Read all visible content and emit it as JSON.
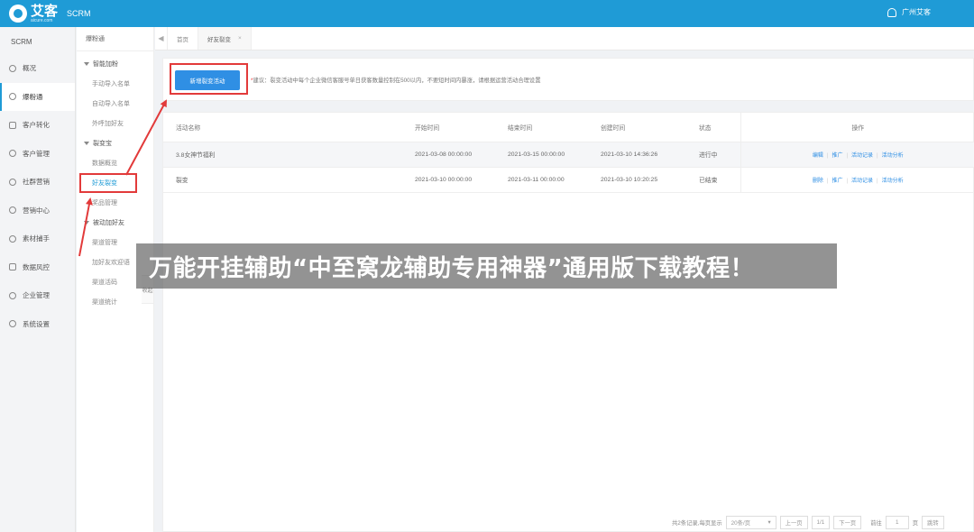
{
  "app": {
    "logo_text": "艾客",
    "logo_url": "aicure.com",
    "product": "SCRM",
    "user_name": "广州艾客"
  },
  "leftnav": {
    "brand": "SCRM",
    "items": [
      {
        "label": "概况",
        "icon": "home-icon"
      },
      {
        "label": "爆粉通",
        "icon": "user-icon",
        "active": true
      },
      {
        "label": "客户转化",
        "icon": "convert-icon"
      },
      {
        "label": "客户管理",
        "icon": "customers-icon"
      },
      {
        "label": "社群营销",
        "icon": "group-icon"
      },
      {
        "label": "营销中心",
        "icon": "marketing-icon"
      },
      {
        "label": "素材捕手",
        "icon": "material-icon"
      },
      {
        "label": "数据风控",
        "icon": "shield-icon"
      },
      {
        "label": "企业管理",
        "icon": "company-icon"
      },
      {
        "label": "系统设置",
        "icon": "gear-icon"
      }
    ]
  },
  "subnav": {
    "head": "爆粉通",
    "groups": [
      {
        "label": "智能加粉",
        "items": [
          "手动导入名单",
          "自动导入名单",
          "外呼加好友"
        ]
      },
      {
        "label": "裂变宝",
        "items": [
          "数据概览",
          "好友裂变",
          "奖品管理"
        ]
      },
      {
        "label": "被动加好友",
        "items": [
          "渠道管理",
          "加好友欢迎语",
          "渠道活码",
          "渠道统计"
        ]
      }
    ],
    "collapse_label": "收起"
  },
  "tabs": {
    "left_arrow": "◀",
    "items": [
      {
        "label": "首页"
      },
      {
        "label": "好友裂变",
        "close": "×"
      }
    ]
  },
  "toolbar": {
    "new_button": "新增裂变活动",
    "tip_star": "*",
    "tip": "建议：裂变活动中每个企业微信客服号单日获客数量控制在500以内，不要短时间内暴涨，请根据运营活动合理设置"
  },
  "table": {
    "headers": [
      "活动名称",
      "开始时间",
      "结束时间",
      "创建时间",
      "状态",
      "操作"
    ],
    "rows": [
      {
        "name": "3.8女神节福利",
        "start": "2021-03-08 00:00:00",
        "end": "2021-03-15 00:00:00",
        "created": "2021-03-10 14:36:26",
        "status": "进行中",
        "ops": [
          "编辑",
          "推广",
          "活动记录",
          "活动分析"
        ]
      },
      {
        "name": "裂变",
        "start": "2021-03-10 00:00:00",
        "end": "2021-03-11 00:00:00",
        "created": "2021-03-10 10:20:25",
        "status": "已结束",
        "ops": [
          "删除",
          "推广",
          "活动记录",
          "活动分析"
        ]
      }
    ]
  },
  "pager": {
    "summary": "共2条记录,每页显示",
    "page_size": "20条/页",
    "prev": "上一页",
    "page": "1/1",
    "next": "下一页",
    "goto_label": "前往",
    "goto_value": "1",
    "page_unit": "页",
    "jump": "跳转"
  },
  "banner": "万能开挂辅助“中至窝龙辅助专用神器”通用版下载教程！",
  "colors": {
    "brand": "#1f9bd6",
    "primary_button": "#2f8fe4",
    "annotation": "#e23a3a"
  }
}
